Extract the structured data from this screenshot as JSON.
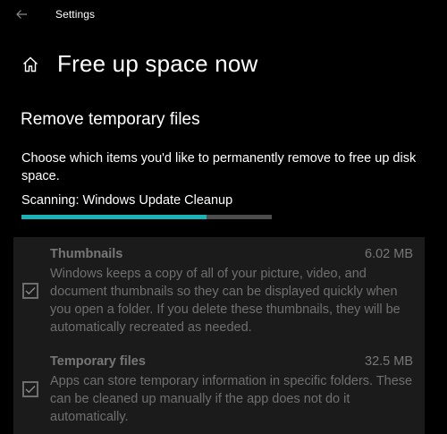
{
  "window": {
    "app_title": "Settings",
    "back_icon": "back-arrow-icon"
  },
  "header": {
    "home_icon": "home-icon",
    "page_title": "Free up space now"
  },
  "section": {
    "title": "Remove temporary files",
    "description": "Choose which items you'd like to permanently remove to free up disk space.",
    "scan_status": "Scanning: Windows Update Cleanup",
    "progress_fraction": 0.74,
    "accent_color": "#1ab3b8"
  },
  "items": [
    {
      "name": "Thumbnails",
      "size": "6.02 MB",
      "description": "Windows keeps a copy of all of your picture, video, and document thumbnails so they can be displayed quickly when you open a folder. If you delete these thumbnails, they will be automatically recreated as needed.",
      "checked": true
    },
    {
      "name": "Temporary files",
      "size": "32.5 MB",
      "description": "Apps can store temporary information in specific folders. These can be cleaned up manually if the app does not do it automatically.",
      "checked": true
    }
  ]
}
